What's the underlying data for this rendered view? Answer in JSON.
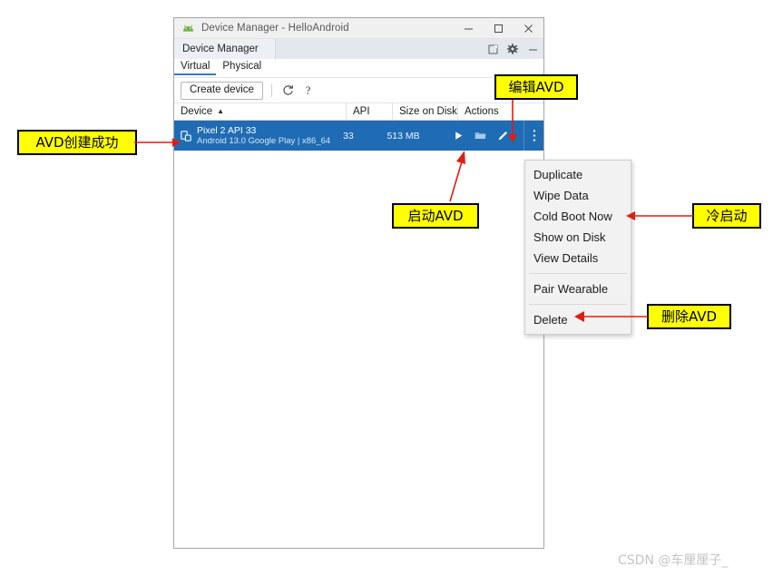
{
  "window": {
    "title": "Device Manager - HelloAndroid",
    "logo_icon": "android-logo-icon",
    "controls": {
      "minimize": "minimize-icon",
      "maximize": "maximize-icon",
      "close": "close-icon"
    }
  },
  "panel": {
    "header_title": "Device Manager",
    "icons": {
      "window_mode": "window-mode-icon",
      "settings": "gear-icon",
      "hide": "minimize-panel-icon"
    }
  },
  "tabs": [
    {
      "label": "Virtual",
      "active": true
    },
    {
      "label": "Physical",
      "active": false
    }
  ],
  "toolbar": {
    "create_device_label": "Create device",
    "refresh_icon": "refresh-icon",
    "help_icon": "help-icon",
    "help_glyph": "?"
  },
  "table": {
    "columns": [
      {
        "key": "device",
        "label": "Device",
        "sorted": true,
        "sort_caret": "▲"
      },
      {
        "key": "api",
        "label": "API"
      },
      {
        "key": "size",
        "label": "Size on Disk"
      },
      {
        "key": "actions",
        "label": "Actions"
      }
    ],
    "rows": [
      {
        "icon": "virtual-device-icon",
        "name": "Pixel 2 API 33",
        "subtitle": "Android 13.0 Google Play | x86_64",
        "api": "33",
        "size_on_disk": "513 MB",
        "selected": true,
        "actions": [
          {
            "name": "launch-device-button",
            "icon": "play-icon"
          },
          {
            "name": "open-folder-button",
            "icon": "folder-icon"
          },
          {
            "name": "edit-device-button",
            "icon": "pencil-icon"
          },
          {
            "name": "more-actions-button",
            "icon": "overflow-menu-icon"
          }
        ]
      }
    ]
  },
  "context_menu": {
    "groups": [
      [
        "Duplicate",
        "Wipe Data",
        "Cold Boot Now",
        "Show on Disk",
        "View Details"
      ],
      [
        "Pair Wearable"
      ],
      [
        "Delete"
      ]
    ]
  },
  "annotations": [
    {
      "id": "created",
      "text": "AVD创建成功"
    },
    {
      "id": "edit",
      "text": "编辑AVD"
    },
    {
      "id": "launch",
      "text": "启动AVD"
    },
    {
      "id": "coldboot",
      "text": "冷启动"
    },
    {
      "id": "delete",
      "text": "删除AVD"
    }
  ],
  "watermark": "CSDN @车厘厘子_",
  "colors": {
    "selection_blue": "#1f6cb4",
    "annotation_fill": "#ffff00",
    "annotation_border": "#000000",
    "arrow_red": "#e11d11",
    "tab_underline": "#3a77c9"
  }
}
